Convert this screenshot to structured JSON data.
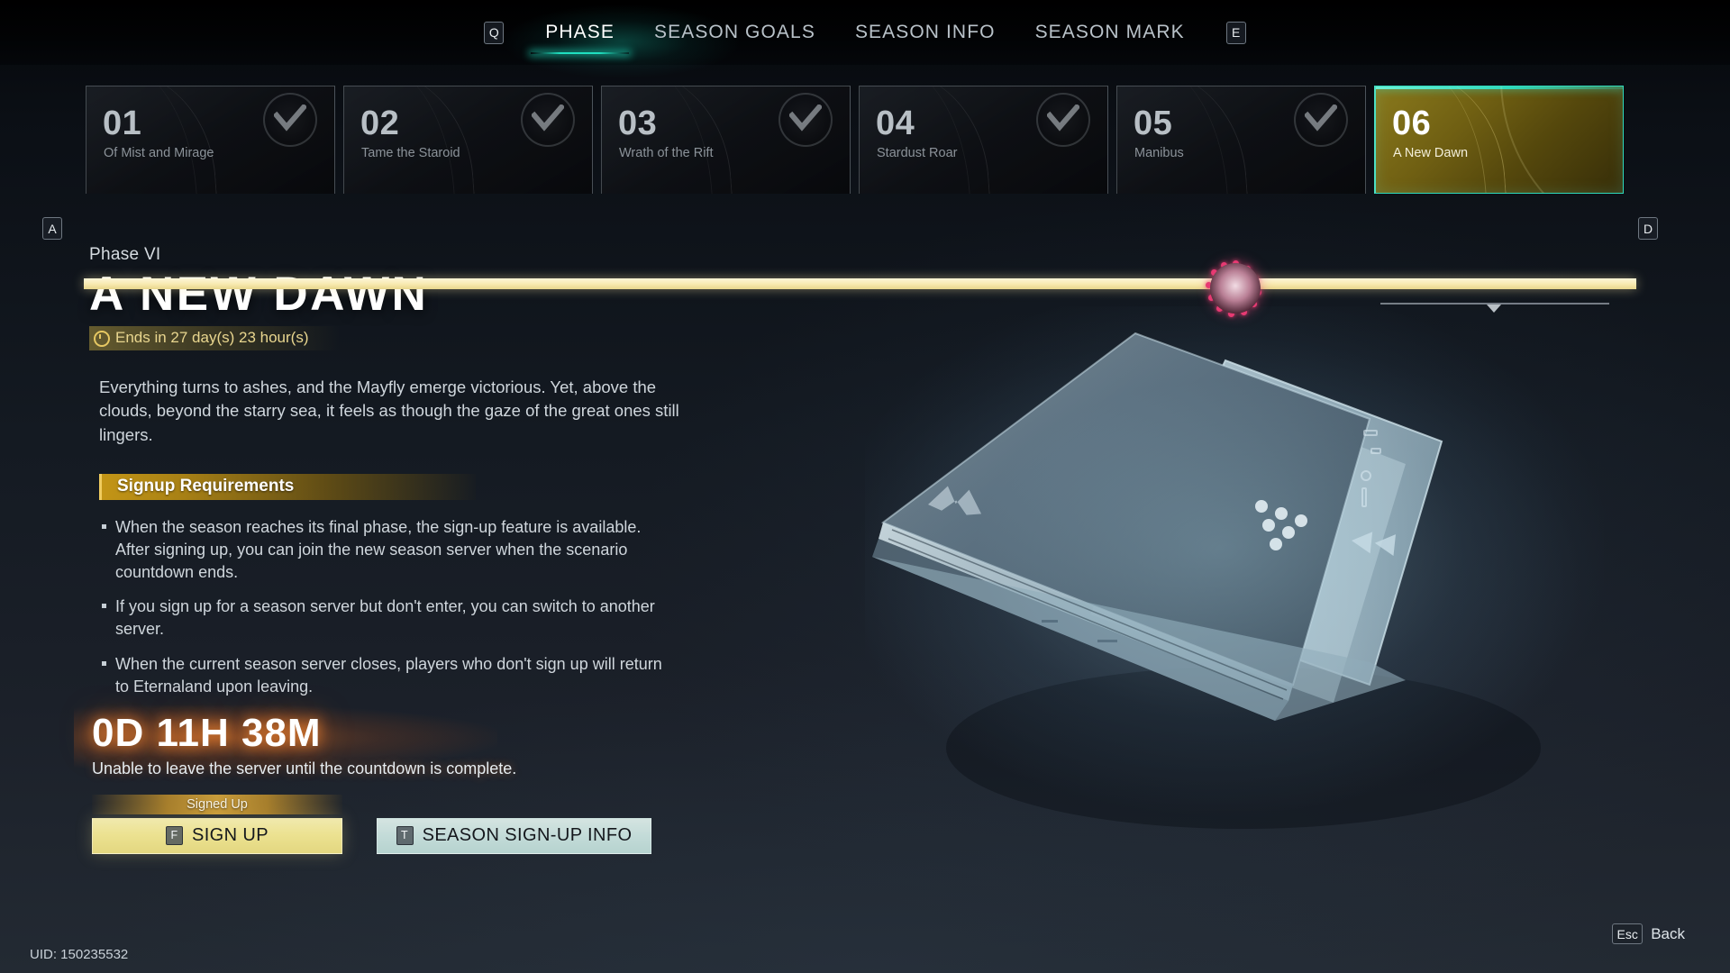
{
  "nav": {
    "left_key": "Q",
    "right_key": "E",
    "tabs": [
      {
        "label": "PHASE",
        "active": true
      },
      {
        "label": "SEASON GOALS",
        "active": false
      },
      {
        "label": "SEASON INFO",
        "active": false
      },
      {
        "label": "SEASON MARK",
        "active": false
      }
    ]
  },
  "phase_strip": {
    "left_key": "A",
    "right_key": "D",
    "cards": [
      {
        "num": "01",
        "name": "Of Mist and Mirage",
        "completed": true,
        "active": false
      },
      {
        "num": "02",
        "name": "Tame the Staroid",
        "completed": true,
        "active": false
      },
      {
        "num": "03",
        "name": "Wrath of the Rift",
        "completed": true,
        "active": false
      },
      {
        "num": "04",
        "name": "Stardust Roar",
        "completed": true,
        "active": false
      },
      {
        "num": "05",
        "name": "Manibus",
        "completed": true,
        "active": false
      },
      {
        "num": "06",
        "name": "A New Dawn",
        "completed": false,
        "active": true
      }
    ]
  },
  "detail": {
    "phase_label": "Phase VI",
    "title": "A NEW DAWN",
    "ends_in": "Ends in 27 day(s) 23 hour(s)",
    "description": "Everything turns to ashes, and the Mayfly emerge victorious. Yet, above the clouds, beyond the starry sea, it feels as though the gaze of the great ones still lingers.",
    "section_title": "Signup Requirements",
    "requirements": [
      "When the season reaches its final phase, the sign-up feature is available. After signing up, you can join the new season server when the scenario countdown ends.",
      "If you sign up for a season server but don't enter, you can switch to another server.",
      "When the current season server closes, players who don't sign up will return to Eternaland upon leaving."
    ],
    "countdown": "0D 11H 38M",
    "countdown_note": "Unable to leave the server until the countdown is complete.",
    "signed_up_ribbon": "Signed Up"
  },
  "buttons": {
    "signup": {
      "key": "F",
      "label": "SIGN UP"
    },
    "season_info": {
      "key": "T",
      "label": "SEASON SIGN-UP INFO"
    }
  },
  "footer": {
    "esc_key": "Esc",
    "back_label": "Back",
    "uid": "UID: 150235532"
  },
  "colors": {
    "accent_teal": "#2fd9bb",
    "accent_gold": "#e3d780",
    "accent_orange": "#ff8c32",
    "info_button": "#c3dbd8",
    "boss_marker": "#e8356f"
  }
}
